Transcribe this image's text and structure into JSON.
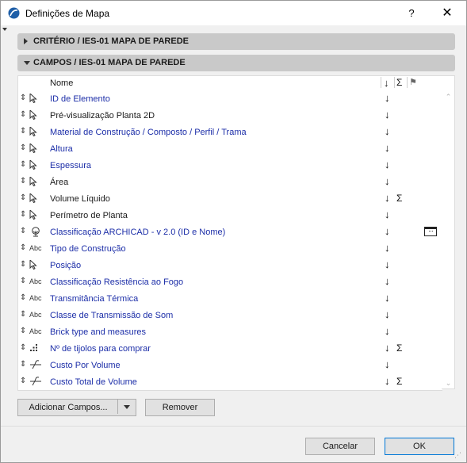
{
  "window": {
    "title": "Definições de Mapa",
    "help": "?",
    "close": "✕"
  },
  "sections": {
    "criteria": "CRITÉRIO / IES-01 MAPA DE PAREDE",
    "fields": "CAMPOS / IES-01 MAPA DE PAREDE"
  },
  "list": {
    "header": {
      "name": "Nome",
      "sort": "↓",
      "sum": "Σ",
      "flag": "⚑"
    },
    "rows": [
      {
        "name": "ID de Elemento",
        "type": "arrow",
        "color": "blue",
        "sort": "↓",
        "sum": "",
        "more": false
      },
      {
        "name": "Pré-visualização Planta 2D",
        "type": "arrow",
        "color": "black",
        "sort": "↓",
        "sum": "",
        "more": false
      },
      {
        "name": "Material de Construção / Composto / Perfil / Trama",
        "type": "arrow",
        "color": "blue",
        "sort": "↓",
        "sum": "",
        "more": false
      },
      {
        "name": "Altura",
        "type": "arrow",
        "color": "blue",
        "sort": "↓",
        "sum": "",
        "more": false
      },
      {
        "name": "Espessura",
        "type": "arrow",
        "color": "blue",
        "sort": "↓",
        "sum": "",
        "more": false
      },
      {
        "name": "Área",
        "type": "arrow",
        "color": "black",
        "sort": "↓",
        "sum": "",
        "more": false
      },
      {
        "name": "Volume Líquido",
        "type": "arrow",
        "color": "black",
        "sort": "↓",
        "sum": "Σ",
        "more": false
      },
      {
        "name": "Perímetro de Planta",
        "type": "arrow",
        "color": "black",
        "sort": "↓",
        "sum": "",
        "more": false
      },
      {
        "name": "Classificação ARCHICAD - v 2.0 (ID e Nome)",
        "type": "tree",
        "color": "blue",
        "sort": "↓",
        "sum": "",
        "more": true
      },
      {
        "name": "Tipo de Construção",
        "type": "abc",
        "color": "blue",
        "sort": "↓",
        "sum": "",
        "more": false
      },
      {
        "name": "Posição",
        "type": "arrow",
        "color": "blue",
        "sort": "↓",
        "sum": "",
        "more": false
      },
      {
        "name": "Classificação Resistência ao Fogo",
        "type": "abc",
        "color": "blue",
        "sort": "↓",
        "sum": "",
        "more": false
      },
      {
        "name": "Transmitância Térmica",
        "type": "abc",
        "color": "blue",
        "sort": "↓",
        "sum": "",
        "more": false
      },
      {
        "name": "Classe de Transmissão de Som",
        "type": "abc",
        "color": "blue",
        "sort": "↓",
        "sum": "",
        "more": false
      },
      {
        "name": "Brick type and measures",
        "type": "abc",
        "color": "blue",
        "sort": "↓",
        "sum": "",
        "more": false
      },
      {
        "name": "Nº de tijolos para comprar",
        "type": "num",
        "color": "blue",
        "sort": "↓",
        "sum": "Σ",
        "more": false
      },
      {
        "name": "Custo Por Volume",
        "type": "formula",
        "color": "blue",
        "sort": "↓",
        "sum": "",
        "more": false
      },
      {
        "name": "Custo Total de Volume",
        "type": "formula",
        "color": "blue",
        "sort": "↓",
        "sum": "Σ",
        "more": false
      }
    ],
    "abc_label": "Abc"
  },
  "buttons": {
    "add_fields": "Adicionar Campos...",
    "remove": "Remover",
    "cancel": "Cancelar",
    "ok": "OK"
  },
  "colors": {
    "blue_text": "#1c2ea8",
    "section_bg": "#c9c9c9",
    "primary_border": "#0078d7"
  }
}
